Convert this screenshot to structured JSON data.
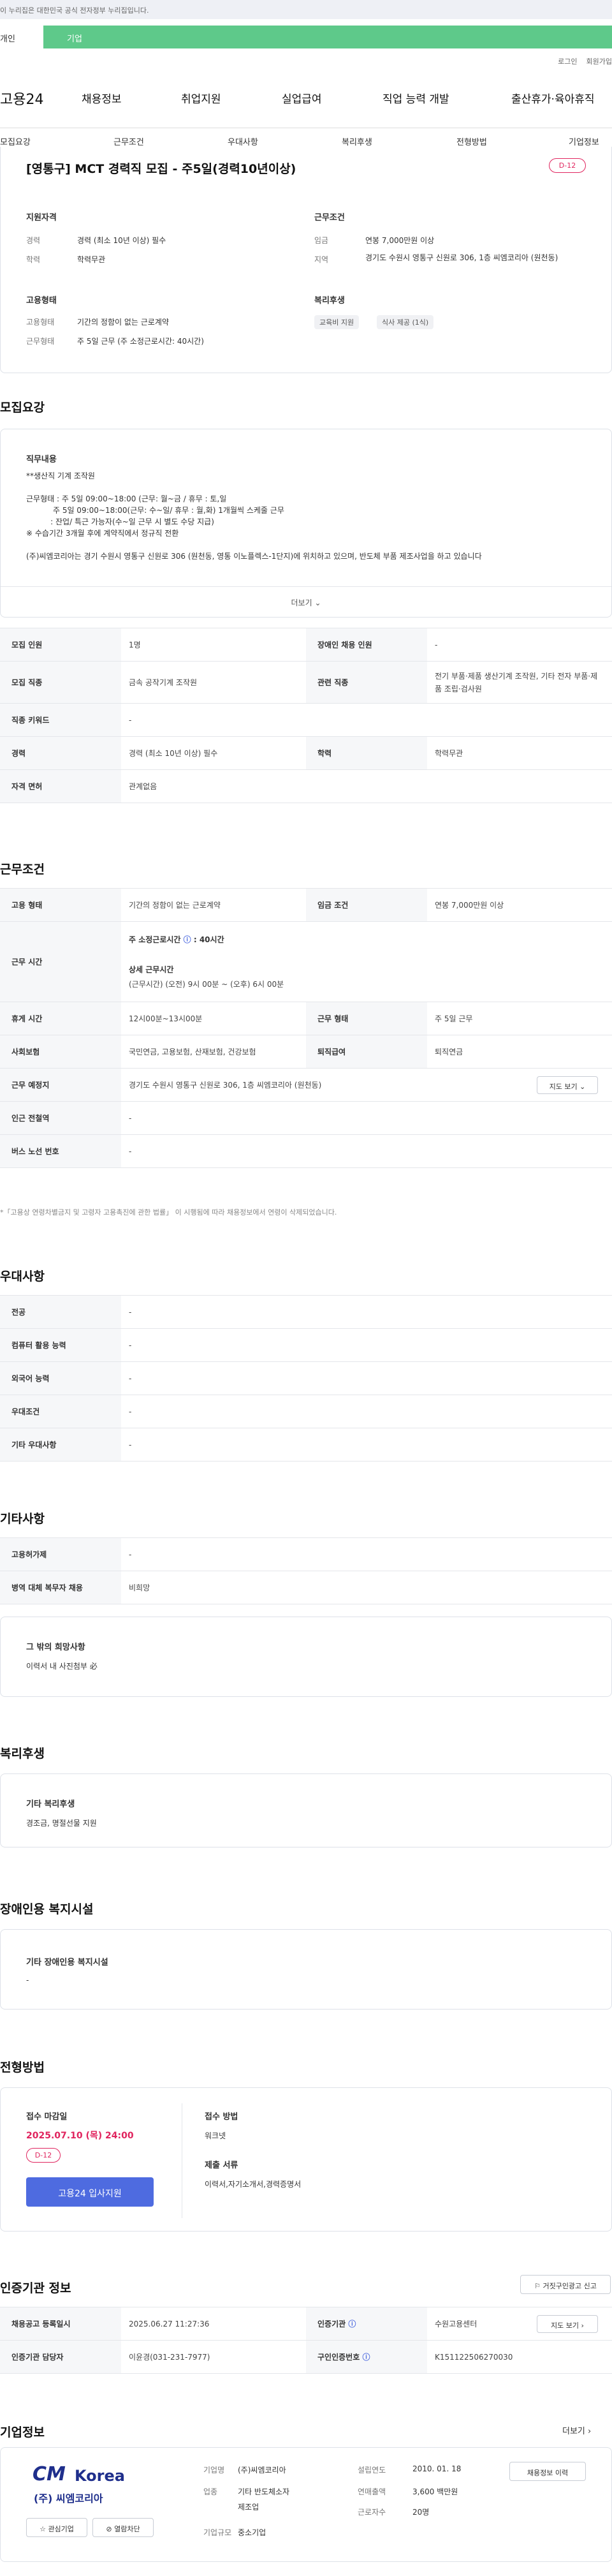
{
  "notice": "이 누리집은 대한민국 공식 전자정부 누리집입니다.",
  "tabs": [
    "개인",
    "기업"
  ],
  "top_links": [
    "로그인",
    "회원가입"
  ],
  "gnb": {
    "logo": "고용24",
    "items": [
      "채용정보",
      "취업지원",
      "실업급여",
      "직업 능력 개발",
      "출산휴가·육아휴직"
    ]
  },
  "subnav": [
    "모집요강",
    "근무조건",
    "우대사항",
    "복리후생",
    "전형방법",
    "기업정보"
  ],
  "summary": {
    "title": "[영통구] MCT 경력직 모집 - 주5일(경력10년이상)",
    "dday": "D-12",
    "qual_title": "지원자격",
    "career_label": "경력",
    "career": "경력 (최소 10년 이상) 필수",
    "edu_label": "학력",
    "edu": "학력무관",
    "cond_title": "근무조건",
    "wage_label": "임금",
    "wage": "연봉 7,000만원 이상",
    "area_label": "지역",
    "area": "경기도 수원시 영통구 신원로 306, 1층 씨엠코리아 (원천동)",
    "emp_title": "고용형태",
    "emp_label": "고용형태",
    "emp": "기간의 정함이 없는 근로계약",
    "hours_label": "근무형태",
    "hours": "주 5일 근무 (주 소정근로시간: 40시간)",
    "welfare_title": "복리후생",
    "welfare_chips": [
      "교육비 지원",
      "식사 제공 (1식)"
    ]
  },
  "recruit": {
    "title": "모집요강",
    "job_title": "직무내용",
    "job_lines": [
      "**생산직 기계 조작원",
      "",
      "근무형태 : 주 5일 09:00~18:00 (근무: 월~금 / 휴무 : 토,일",
      "           주 5일 09:00~18:00(근무: 수~일/ 휴무 : 월,화) 1개월씩 스케줄 근무",
      "          : 잔업/ 특근 가능자(수~일 근무 시 별도 수당 지급)",
      "※ 수습기간 3개월 후에 계약직에서 정규직 전환",
      "",
      "(주)씨엠코리아는 경기 수원시 영통구 신원로 306 (원천동, 영통 이노플렉스-1단지)에 위치하고 있으며, 반도체 부품 제조사업을 하고 있습니다"
    ],
    "more": "더보기",
    "rows": [
      [
        "모집 인원",
        "1명",
        "장애인 채용 인원",
        "-"
      ],
      [
        "모집 직종",
        "금속 공작기계 조작원",
        "관련 직종",
        "전기 부품·제품 생산기계 조작원, 기타 전자 부품·제품 조립·검사원"
      ],
      [
        "직종 키워드",
        "-",
        "",
        ""
      ],
      [
        "경력",
        "경력 (최소 10년 이상) 필수",
        "학력",
        "학력무관"
      ],
      [
        "자격 면허",
        "관계없음",
        "",
        ""
      ]
    ]
  },
  "work": {
    "title": "근무조건",
    "emp_k": "고용 형태",
    "emp_v": "기간의 정함이 없는 근로계약",
    "wage_k": "임금 조건",
    "wage_v": "연봉 7,000만원 이상",
    "time_k": "근무 시간",
    "time_week_label": "주 소정근로시간",
    "time_week": "40시간",
    "time_detail_label": "상세 근무시간",
    "time_detail": "(근무시간) (오전) 9시 00분 ~ (오후) 6시 00분",
    "rest_k": "휴게 시간",
    "rest_v": "12시00분~13시00분",
    "type_k": "근무 형태",
    "type_v": "주 5일 근무",
    "ins_k": "사회보험",
    "ins_v": "국민연금, 고용보험, 산재보험, 건강보험",
    "ret_k": "퇴직급여",
    "ret_v": "퇴직연금",
    "place_k": "근무 예정지",
    "place_v": "경기도 수원시 영통구 신원로 306, 1층 씨엠코리아 (원천동)",
    "map_btn": "지도 보기",
    "sub_k": "인근 전철역",
    "sub_v": "-",
    "bus_k": "버스 노선 번호",
    "bus_v": "-",
    "footnote": "*「고용상 연령차별금지 및 고령자 고용촉진에 관한 법률」 이 시행됨에 따라 채용정보에서 연령이 삭제되었습니다."
  },
  "pref": {
    "title": "우대사항",
    "rows": [
      [
        "전공",
        "-"
      ],
      [
        "컴퓨터 활용 능력",
        "-"
      ],
      [
        "외국어 능력",
        "-"
      ],
      [
        "우대조건",
        "-"
      ],
      [
        "기타 우대사항",
        "-"
      ]
    ]
  },
  "etc": {
    "title": "기타사항",
    "rows": [
      [
        "고용허가제",
        "-"
      ],
      [
        "병역 대체 복무자 채용",
        "비희망"
      ]
    ],
    "box_title": "그 밖의 희망사항",
    "box_text": "이력서 내 사진첨부 必"
  },
  "welfare": {
    "title": "복리후생",
    "box_title": "기타 복리후생",
    "box_text": "경조금, 명절선물 지원"
  },
  "disab": {
    "title": "장애인용 복지시설",
    "box_title": "기타 장애인용 복지시설",
    "box_text": "-"
  },
  "screen": {
    "title": "전형방법",
    "deadline_label": "접수 마감일",
    "deadline": "2025.07.10 (목) 24:00",
    "dday": "D-12",
    "apply_btn": "고용24 입사지원",
    "method_label": "접수 방법",
    "method": "워크넷",
    "docs_label": "제출 서류",
    "docs": "이력서,자기소개서,경력증명서"
  },
  "agency": {
    "title": "인증기관 정보",
    "report_btn": "거짓구인광고 신고",
    "reg_k": "채용공고 등록일시",
    "reg_v": "2025.06.27 11:27:36",
    "org_k": "인증기관",
    "org_v": "수원고용센터",
    "map_btn": "지도 보기",
    "mgr_k": "인증기관 담당자",
    "mgr_v": "이윤경(031-231-7977)",
    "no_k": "구인인증번호",
    "no_v": "K151122506270030"
  },
  "company": {
    "title": "기업정보",
    "more": "더보기",
    "logo_mark": "CM",
    "logo_word": "Korea",
    "logo_sub": "(주) 씨엠코리아",
    "fav_btn": "관심기업",
    "block_btn": "열람차단",
    "name_k": "기업명",
    "name_v": "(주)씨엠코리아",
    "ind_k": "업종",
    "ind_v1": "기타 반도체소자",
    "ind_v2": "제조업",
    "size_k": "기업규모",
    "size_v": "중소기업",
    "est_k": "설립연도",
    "est_v": "2010. 01. 18",
    "rev_k": "연매출액",
    "rev_v": "3,600 백만원",
    "emp_k": "근로자수",
    "emp_v": "20명",
    "jobs_btn": "채용정보 이력"
  },
  "colors": {
    "accent": "#4e6be0",
    "green": "#5ec98a",
    "red": "#e0245e",
    "logo": "#1f2f8c"
  }
}
